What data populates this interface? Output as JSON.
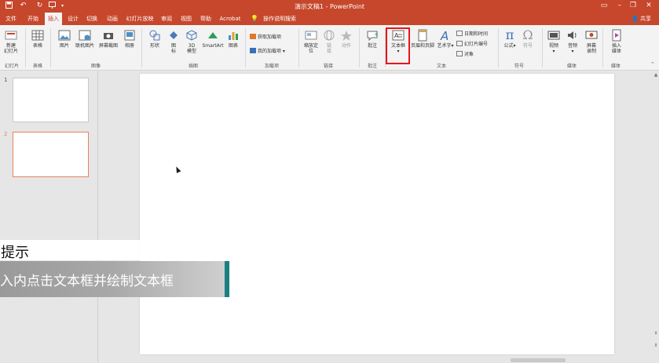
{
  "titlebar": {
    "document_title": "演示文稿1 - PowerPoint",
    "quick_access": [
      "save-icon",
      "undo-icon",
      "redo-icon",
      "present-icon"
    ],
    "window_controls": [
      "ribbon-display-icon",
      "minimize-icon",
      "restore-icon",
      "close-icon"
    ]
  },
  "tabs": [
    "文件",
    "开始",
    "插入",
    "设计",
    "切换",
    "动画",
    "幻灯片放映",
    "审阅",
    "视图",
    "帮助",
    "Acrobat"
  ],
  "active_tab": "插入",
  "tell_me": "操作说明搜索",
  "share": "共享",
  "ribbon": {
    "slides": {
      "new_slide": "新建",
      "new_slide_2": "幻灯片",
      "group": "幻灯片"
    },
    "tables": {
      "table": "表格",
      "group": "表格"
    },
    "images": {
      "picture": "图片",
      "online_picture": "联机图片",
      "screenshot": "屏幕截图",
      "album": "相册",
      "group": "图像"
    },
    "illustrations": {
      "shapes": "形状",
      "icons": "图",
      "icons_2": "标",
      "model_3d": "3D",
      "model_3d_2": "模型",
      "smartart": "SmartArt",
      "chart": "图表",
      "group": "插图"
    },
    "addins": {
      "get_addins": "获取加载项",
      "my_addins": "我的加载项",
      "group": "加载项"
    },
    "links": {
      "zoom": "缩放定",
      "zoom_2": "位",
      "link": "链",
      "link_2": "接",
      "action": "动作",
      "group": "链接"
    },
    "comments": {
      "comment": "批注",
      "group": "批注"
    },
    "text": {
      "textbox": "文本框",
      "header_footer": "页眉和页脚",
      "wordart": "艺术字",
      "date_time": "日期和时间",
      "slide_number": "幻灯片编号",
      "object": "对象",
      "group": "文本"
    },
    "symbols": {
      "equation": "公式",
      "symbol": "符号",
      "group": "符号"
    },
    "media": {
      "video": "视频",
      "audio": "音频",
      "screen_record": "屏幕",
      "screen_record_2": "录制",
      "group": "媒体"
    },
    "flash": {
      "insert_media": "插入",
      "insert_media_2": "媒体",
      "group": "媒体"
    }
  },
  "slides": [
    "1",
    "2"
  ],
  "selected_slide": "2",
  "tip": {
    "title": "提示",
    "body": "入内点击文本框并绘制文本框"
  },
  "colors": {
    "accent": "#c6472b",
    "highlight": "#e8141a",
    "tip_accent": "#1b7f83",
    "selected_thumb": "#e8825e"
  }
}
